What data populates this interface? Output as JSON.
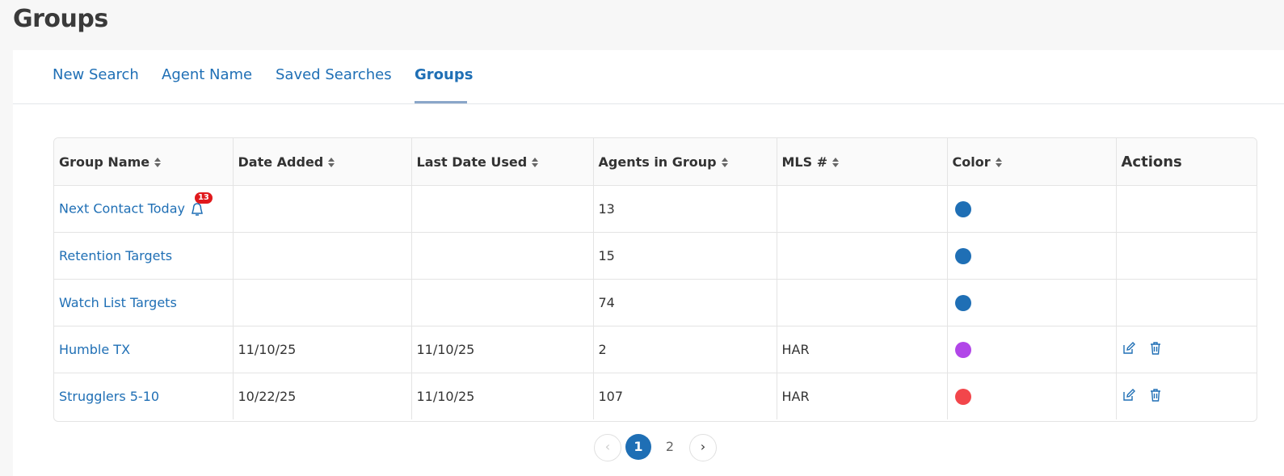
{
  "page": {
    "title": "Groups"
  },
  "tabs": [
    {
      "label": "New Search"
    },
    {
      "label": "Agent Name"
    },
    {
      "label": "Saved Searches"
    },
    {
      "label": "Groups",
      "active": true
    }
  ],
  "table": {
    "headers": [
      "Group Name",
      "Date Added",
      "Last Date Used",
      "Agents in Group",
      "MLS #",
      "Color",
      "Actions"
    ],
    "rows": [
      {
        "name": "Next Contact Today",
        "notification_count": "13",
        "date_added": "",
        "last_used": "",
        "agents": "13",
        "mls": "",
        "color": "#1f6fb5",
        "actions": false
      },
      {
        "name": "Retention Targets",
        "date_added": "",
        "last_used": "",
        "agents": "15",
        "mls": "",
        "color": "#1f6fb5",
        "actions": false
      },
      {
        "name": "Watch List Targets",
        "date_added": "",
        "last_used": "",
        "agents": "74",
        "mls": "",
        "color": "#1f6fb5",
        "actions": false
      },
      {
        "name": "Humble TX",
        "date_added": "11/10/25",
        "last_used": "11/10/25",
        "agents": "2",
        "mls": "HAR",
        "color": "#b146e8",
        "actions": true
      },
      {
        "name": "Strugglers 5-10",
        "date_added": "10/22/25",
        "last_used": "11/10/25",
        "agents": "107",
        "mls": "HAR",
        "color": "#f2464b",
        "actions": true
      }
    ]
  },
  "pagination": {
    "prev": "‹",
    "pages": [
      "1",
      "2"
    ],
    "current": "1",
    "next": "›"
  },
  "colors": {
    "accent": "#1f6fb5",
    "badge": "#e0191c"
  }
}
